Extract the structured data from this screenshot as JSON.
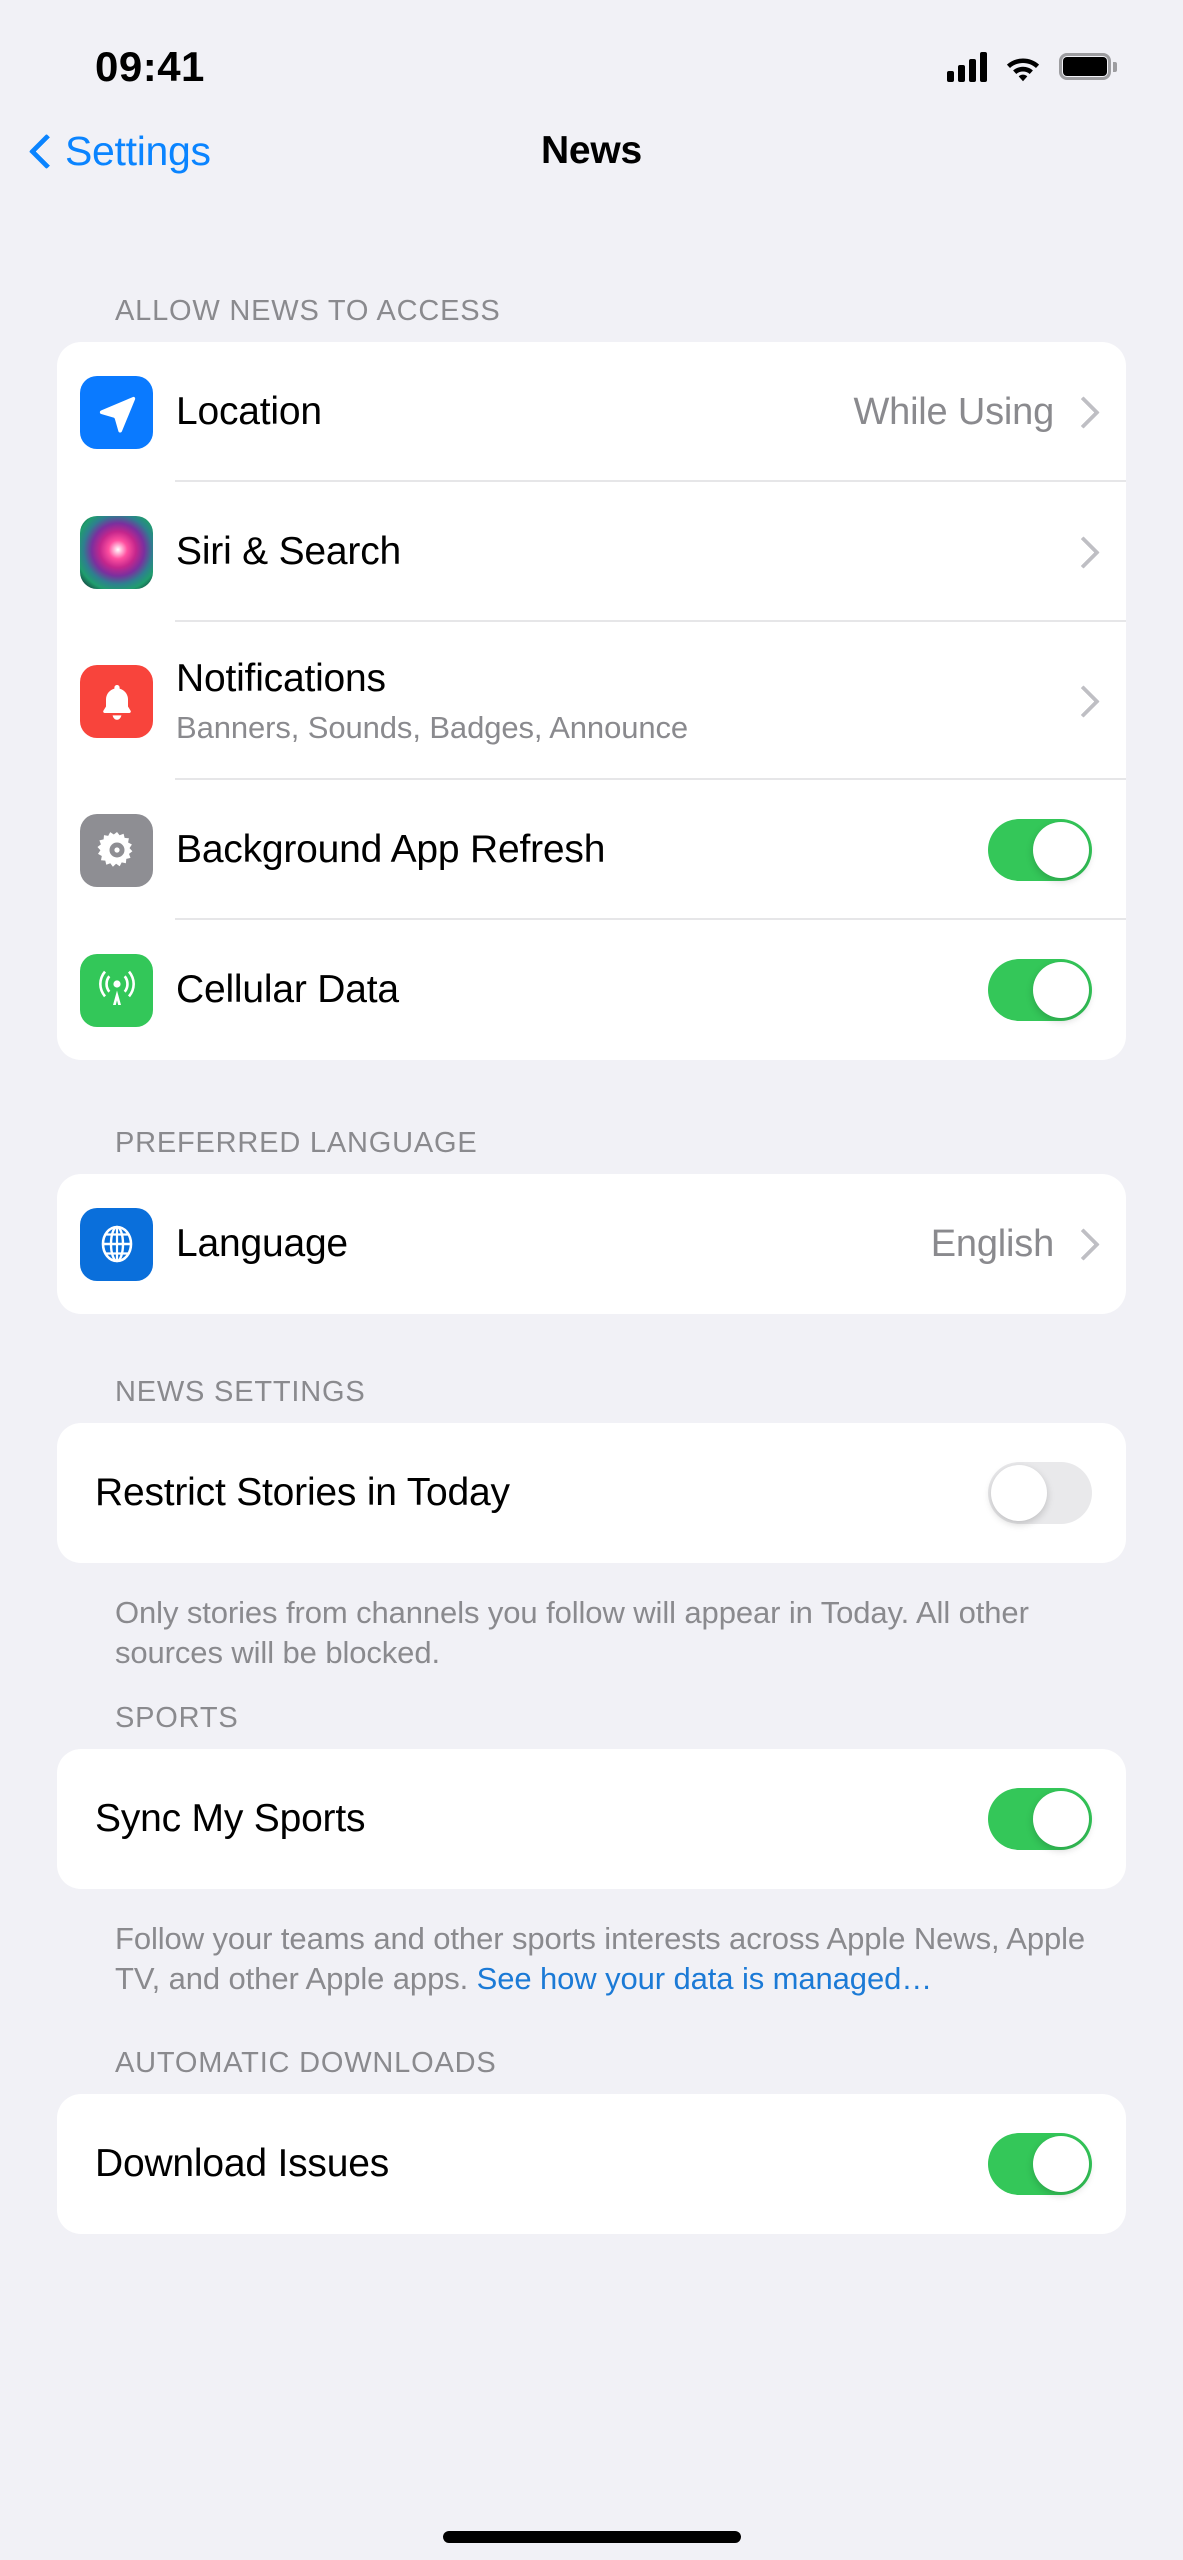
{
  "status_bar": {
    "time": "09:41",
    "cellular_icon": "cellular-signal-icon",
    "wifi_icon": "wifi-icon",
    "battery_icon": "battery-full-icon"
  },
  "nav": {
    "back_label": "Settings",
    "title": "News"
  },
  "colors": {
    "accent_blue": "#0a84ff",
    "link_blue": "#1b7ad6",
    "toggle_on_green": "#34c759",
    "toggle_off_gray": "#e9e9eb",
    "page_background": "#f1f1f6",
    "card_background": "#ffffff",
    "secondary_text": "#8a8a8e"
  },
  "sections": [
    {
      "header": "ALLOW NEWS TO ACCESS",
      "rows": [
        {
          "title": "Location",
          "subtitle": "",
          "icon": "location-arrow-icon",
          "value": "While Using",
          "accessory": "chevron"
        },
        {
          "title": "Siri & Search",
          "subtitle": "",
          "icon": "siri-orb-icon",
          "value": "",
          "accessory": "chevron"
        },
        {
          "title": "Notifications",
          "subtitle": "Banners, Sounds, Badges, Announce",
          "icon": "notification-bell-icon",
          "value": "",
          "accessory": "chevron"
        },
        {
          "title": "Background App Refresh",
          "subtitle": "",
          "icon": "gear-icon",
          "value": "",
          "accessory": "toggle",
          "toggle": "on"
        },
        {
          "title": "Cellular Data",
          "subtitle": "",
          "icon": "cellular-antenna-icon",
          "value": "",
          "accessory": "toggle",
          "toggle": "on"
        }
      ]
    },
    {
      "header": "PREFERRED LANGUAGE",
      "rows": [
        {
          "title": "Language",
          "subtitle": "",
          "icon": "globe-icon",
          "value": "English",
          "accessory": "chevron"
        }
      ]
    },
    {
      "header": "NEWS SETTINGS",
      "rows": [
        {
          "title": "Restrict Stories in Today",
          "subtitle": "",
          "icon": "",
          "value": "",
          "accessory": "toggle",
          "toggle": "off"
        }
      ],
      "footer": "Only stories from channels you follow will appear in Today. All other sources will be blocked."
    },
    {
      "header": "SPORTS",
      "rows": [
        {
          "title": "Sync My Sports",
          "subtitle": "",
          "icon": "",
          "value": "",
          "accessory": "toggle",
          "toggle": "on"
        }
      ],
      "footer": "Follow your teams and other sports interests across Apple News, Apple TV, and other Apple apps. ",
      "footer_link": "See how your data is managed…"
    },
    {
      "header": "AUTOMATIC DOWNLOADS",
      "rows": [
        {
          "title": "Download Issues",
          "subtitle": "",
          "icon": "",
          "value": "",
          "accessory": "toggle",
          "toggle": "on"
        }
      ]
    }
  ]
}
